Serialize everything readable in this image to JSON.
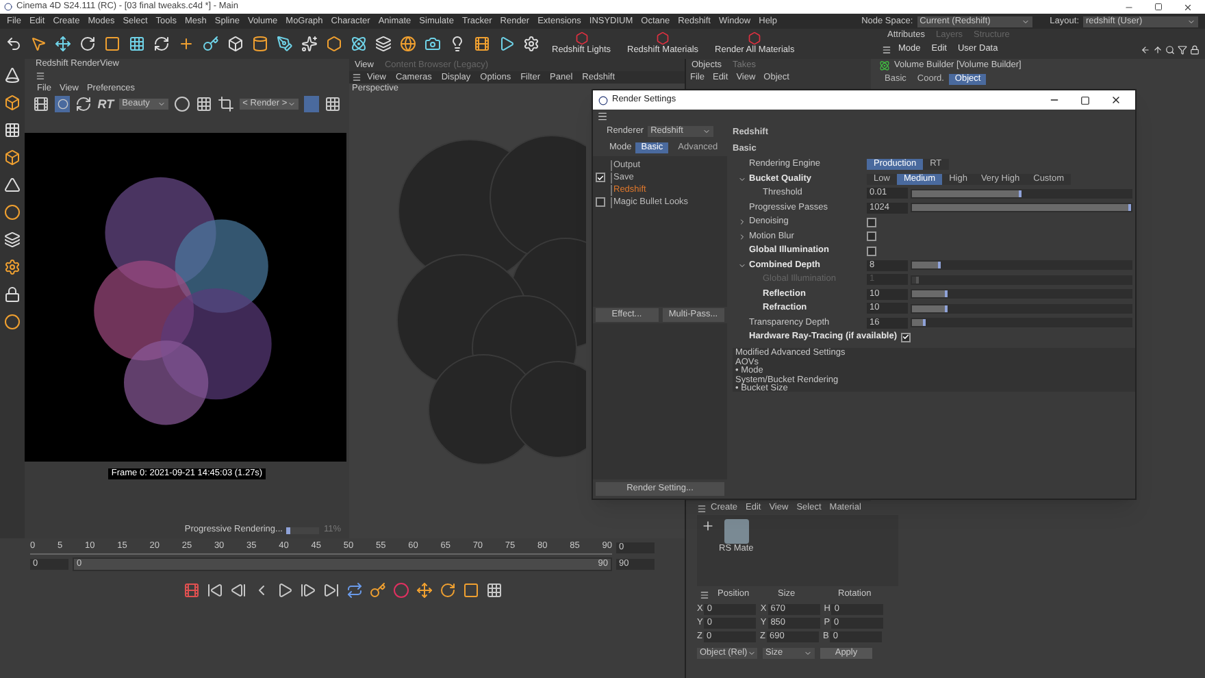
{
  "app_title": "Cinema 4D S24.111 (RC) - [03 final tweaks.c4d *] - Main",
  "menu": [
    "File",
    "Edit",
    "Create",
    "Modes",
    "Select",
    "Tools",
    "Mesh",
    "Spline",
    "Volume",
    "MoGraph",
    "Character",
    "Animate",
    "Simulate",
    "Tracker",
    "Render",
    "Extensions",
    "INSYDIUM",
    "Octane",
    "Redshift",
    "Window",
    "Help"
  ],
  "node_space": {
    "label": "Node Space:",
    "value": "Current (Redshift)"
  },
  "layout": {
    "label": "Layout:",
    "value": "redshift (User)"
  },
  "toolbar_buttons": [
    "Redshift Lights",
    "Redshift Materials",
    "Render All Materials"
  ],
  "render_view": {
    "title": "Redshift RenderView",
    "menu": [
      "File",
      "View",
      "Preferences"
    ],
    "rt_label": "RT",
    "aov": "Beauty",
    "camera": "< Render >",
    "frame_info": "Frame 0: 2021-09-21 14:45:03 (1.27s)",
    "progress_label": "Progressive Rendering...",
    "progress": {
      "level": 0.11,
      "reading": "11%"
    }
  },
  "viewport": {
    "tabs": [
      {
        "label": "View",
        "selected": true
      },
      {
        "label": "Content Browser (Legacy)",
        "selected": false
      }
    ],
    "menu": [
      "View",
      "Cameras",
      "Display",
      "Options",
      "Filter",
      "Panel",
      "Redshift"
    ],
    "camera": "Perspective"
  },
  "objects_panel": {
    "tabs": [
      {
        "label": "Objects",
        "selected": true
      },
      {
        "label": "Takes",
        "selected": false
      }
    ],
    "menu": [
      "File",
      "Edit",
      "View",
      "Object"
    ]
  },
  "attributes": {
    "tabs": [
      {
        "label": "Attributes",
        "selected": true
      },
      {
        "label": "Layers",
        "selected": false
      },
      {
        "label": "Structure",
        "selected": false
      }
    ],
    "menu": [
      "Mode",
      "Edit",
      "User Data"
    ],
    "object": "Volume Builder [Volume Builder]",
    "subtabs": [
      {
        "label": "Basic",
        "selected": false
      },
      {
        "label": "Coord.",
        "selected": false
      },
      {
        "label": "Object",
        "selected": true
      }
    ]
  },
  "render_settings": {
    "title": "Render Settings",
    "renderer_label": "Renderer",
    "renderer": "Redshift",
    "mode_label": "Mode",
    "modes": [
      {
        "label": "Basic",
        "selected": true
      },
      {
        "label": "Advanced",
        "selected": false
      }
    ],
    "tree": [
      {
        "label": "Output",
        "selected": false
      },
      {
        "label": "Save",
        "checked": true,
        "selected": false
      },
      {
        "label": "Redshift",
        "selected": true
      },
      {
        "label": "Magic Bullet Looks",
        "checked": false,
        "selected": false
      }
    ],
    "buttons": [
      "Effect...",
      "Multi-Pass..."
    ],
    "bottom_button": "Render Setting...",
    "section": "Redshift",
    "subsection": "Basic",
    "rows": [
      {
        "kind": "segment",
        "label": "Rendering Engine",
        "options": [
          {
            "label": "Production",
            "selected": true
          },
          {
            "label": "RT",
            "selected": false
          }
        ]
      },
      {
        "kind": "segment",
        "label": "Bucket Quality",
        "expanded": true,
        "emphasis": true,
        "options": [
          {
            "label": "Low",
            "selected": false
          },
          {
            "label": "Medium",
            "selected": true
          },
          {
            "label": "High",
            "selected": false
          },
          {
            "label": "Very High",
            "selected": false
          },
          {
            "label": "Custom",
            "selected": false
          }
        ]
      },
      {
        "kind": "slider",
        "label": "Threshold",
        "indent": true,
        "value": "0.01",
        "level": 0.5
      },
      {
        "kind": "slider",
        "label": "Progressive Passes",
        "value": "1024",
        "level": 1
      },
      {
        "kind": "check",
        "label": "Denoising",
        "expanded": false,
        "checked": false
      },
      {
        "kind": "check",
        "label": "Motion Blur",
        "expanded": false,
        "checked": false
      },
      {
        "kind": "check",
        "label": "Global Illumination",
        "emphasis": true,
        "checked": false
      },
      {
        "kind": "slider",
        "label": "Combined Depth",
        "expanded": true,
        "emphasis": true,
        "value": "8",
        "level": 0.13
      },
      {
        "kind": "slider",
        "label": "Global Illumination",
        "indent": true,
        "disabled": true,
        "value": "1",
        "level": 0.03
      },
      {
        "kind": "slider",
        "label": "Reflection",
        "indent": true,
        "emphasis": true,
        "value": "10",
        "level": 0.16
      },
      {
        "kind": "slider",
        "label": "Refraction",
        "indent": true,
        "emphasis": true,
        "value": "10",
        "level": 0.16
      },
      {
        "kind": "slider",
        "label": "Transparency Depth",
        "value": "16",
        "level": 0.06
      },
      {
        "kind": "check",
        "label": "Hardware Ray-Tracing (if available)",
        "emphasis": true,
        "checked": true
      }
    ],
    "notes": [
      "Modified Advanced Settings",
      "AOVs",
      "• Mode",
      "System/Bucket Rendering",
      "• Bucket Size"
    ]
  },
  "timeline": {
    "ticks": [
      "0",
      "5",
      "10",
      "15",
      "20",
      "25",
      "30",
      "35",
      "40",
      "45",
      "50",
      "55",
      "60",
      "65",
      "70",
      "75",
      "80",
      "85",
      "90"
    ],
    "current_frame": "0",
    "start": "0",
    "range": {
      "start": "0",
      "end": "90",
      "level": 1
    },
    "end": "90"
  },
  "materials": {
    "menu": [
      "Create",
      "Edit",
      "View",
      "Select",
      "Material"
    ],
    "items": [
      {
        "name": "RS Mate"
      }
    ]
  },
  "coordinates": {
    "headers": [
      "Position",
      "Size",
      "Rotation"
    ],
    "rows": [
      {
        "cells": [
          {
            "axis": "X",
            "value": "0"
          },
          {
            "axis": "X",
            "value": "670"
          },
          {
            "axis": "H",
            "value": "0"
          }
        ]
      },
      {
        "cells": [
          {
            "axis": "Y",
            "value": "0"
          },
          {
            "axis": "Y",
            "value": "850"
          },
          {
            "axis": "P",
            "value": "0"
          }
        ]
      },
      {
        "cells": [
          {
            "axis": "Z",
            "value": "0"
          },
          {
            "axis": "Z",
            "value": "690"
          },
          {
            "axis": "B",
            "value": "0"
          }
        ]
      }
    ],
    "mode": "Object (Rel)",
    "size_mode": "Size",
    "apply": "Apply"
  }
}
